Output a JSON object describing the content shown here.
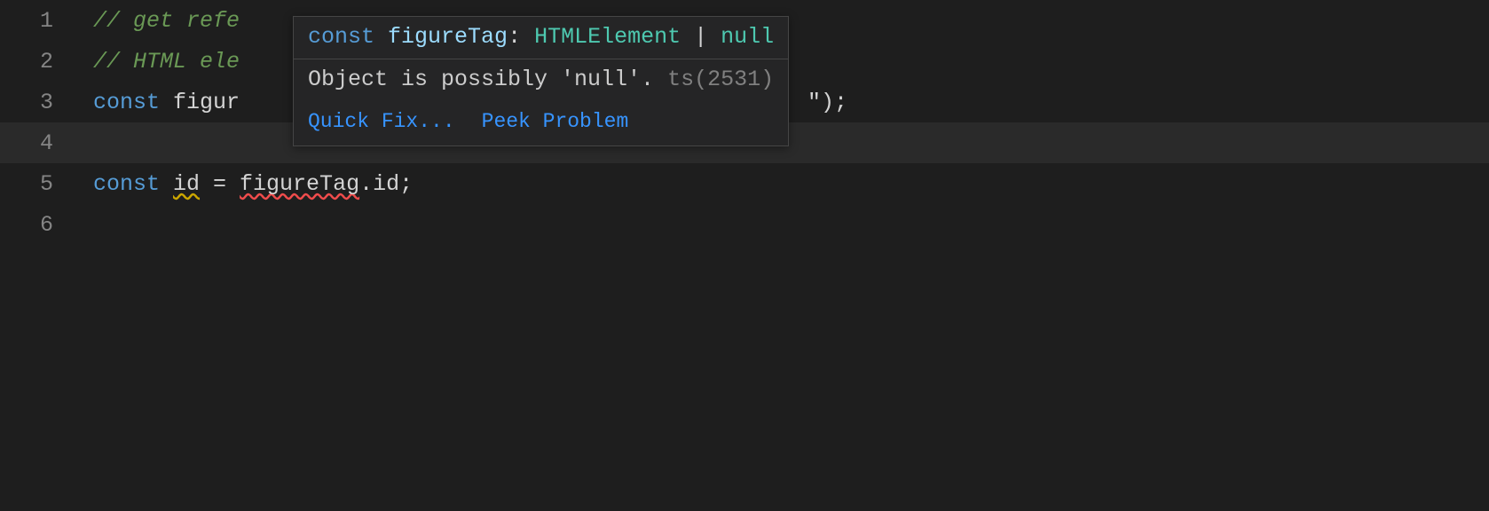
{
  "lines": {
    "l1": {
      "no": "1",
      "comment": "// get refe"
    },
    "l2": {
      "no": "2",
      "comment": "// HTML ele"
    },
    "l3": {
      "no": "3",
      "kw": "const ",
      "var": "figur",
      "tail": "\");"
    },
    "l4": {
      "no": "4"
    },
    "l5": {
      "no": "5",
      "kw": "const ",
      "id_var": "id",
      "eq": " = ",
      "ft": "figureTag",
      "dot": ".",
      "prop": "id",
      "semi": ";"
    },
    "l6": {
      "no": "6"
    }
  },
  "hover": {
    "signature": {
      "kw": "const",
      "sp1": " ",
      "name": "figureTag",
      "colon": ":",
      "sp2": " ",
      "type": "HTMLElement",
      "sp3": " ",
      "pipe": "|",
      "sp4": " ",
      "null": "null"
    },
    "message": "Object is possibly 'null'.",
    "source": " ts(2531)",
    "actions": {
      "quickfix": "Quick Fix...",
      "peek": "Peek Problem"
    }
  }
}
